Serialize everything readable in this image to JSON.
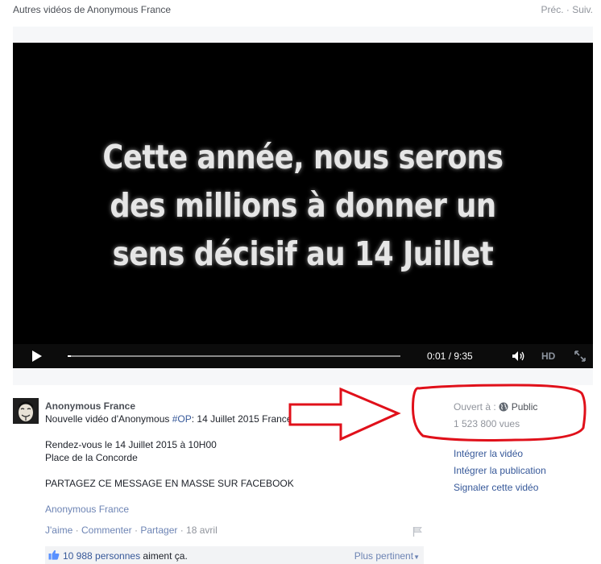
{
  "header": {
    "title": "Autres vidéos de Anonymous France",
    "prev_label": "Préc.",
    "separator": " · ",
    "next_label": "Suiv."
  },
  "video": {
    "caption_lines": [
      "Cette année, nous serons",
      "des millions à donner un",
      "sens décisif au 14 Juillet"
    ],
    "time_display": "0:01 / 9:35",
    "progress": 0.0017,
    "hd_label": "HD"
  },
  "post": {
    "page_name": "Anonymous France",
    "message_prefix": "Nouvelle vidéo d'Anonymous ",
    "hashtag": "#OP",
    "message_suffix": ": 14 Juillet 2015 France",
    "line_rdv": "Rendez-vous le 14 Juillet 2015 à 10H00",
    "line_place": "Place de la Concorde",
    "line_share": "PARTAGEZ CE MESSAGE EN MASSE SUR FACEBOOK",
    "signature": "Anonymous France",
    "actions": {
      "like": "J'aime",
      "comment": "Commenter",
      "share": "Partager",
      "date": "18 avril",
      "separator": " · "
    },
    "likes": {
      "count_text": "10 988 personnes",
      "suffix": " aiment ça.",
      "sort_label": "Plus pertinent"
    }
  },
  "sidebar": {
    "opened_label": "Ouvert à :",
    "privacy": "Public",
    "views": "1 523 800 vues",
    "links": [
      "Intégrer la vidéo",
      "Intégrer la publication",
      "Signaler cette vidéo"
    ]
  },
  "colors": {
    "link": "#365899",
    "annotation_red": "#e0101a",
    "video_bg": "#000000"
  }
}
